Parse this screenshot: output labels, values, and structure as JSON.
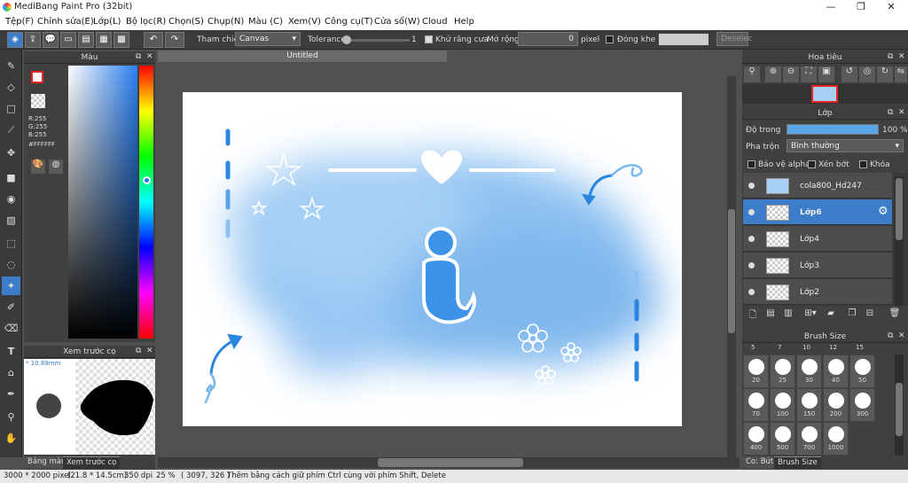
{
  "window": {
    "title": "MediBang Paint Pro (32bit)",
    "min": "—",
    "max": "❐",
    "close": "✕"
  },
  "menu": [
    "Tệp(F)",
    "Chỉnh sửa(E)",
    "Lớp(L)",
    "Bộ lọc(R)",
    "Chọn(S)",
    "Chụp(N)",
    "Màu (C)",
    "Xem(V)",
    "Công cụ(T)",
    "Cửa sổ(W)",
    "Cloud",
    "Help"
  ],
  "toolbar": {
    "ref_label": "Tham chiếu",
    "ref_value": "Canvas",
    "tol_label": "Tolerance",
    "tol_value": "1",
    "aa_label": "Khử răng cưa",
    "expand_label": "Mở rộng",
    "expand_value": "0",
    "pixel_label": "pixel",
    "gap_label": "Đóng khe hở",
    "deselect": "Deselec"
  },
  "color": {
    "title": "Màu",
    "r": "R:255",
    "g": "G:255",
    "b": "B:255",
    "hex": "#FFFFFF"
  },
  "preview": {
    "title": "Xem trước cọ",
    "size": "* 10.89mm",
    "tab1": "Bảng màu",
    "tab2": "Xem trước cọ"
  },
  "canvas": {
    "tab": "Untitled"
  },
  "navigator": {
    "title": "Hoa tiêu"
  },
  "layers": {
    "title": "Lớp",
    "opacity_label": "Độ trong",
    "opacity_value": "100 %",
    "opacity": 1.0,
    "blend_label": "Pha trộn",
    "blend_value": "Bình thường",
    "protect": "Bảo vệ alpha",
    "clip": "Xén bớt",
    "lock": "Khóa",
    "items": [
      {
        "name": "cola800_Hd247"
      },
      {
        "name": "Lớp6"
      },
      {
        "name": "Lớp4"
      },
      {
        "name": "Lớp3"
      },
      {
        "name": "Lớp2"
      }
    ]
  },
  "brushsize": {
    "title": "Brush Size",
    "top": [
      "5",
      "7",
      "10",
      "12",
      "15"
    ],
    "rows": [
      [
        "20",
        "25",
        "30",
        "40",
        "50"
      ],
      [
        "70",
        "100",
        "150",
        "200",
        "300"
      ],
      [
        "400",
        "500",
        "700",
        "1000"
      ]
    ],
    "tab1": "Co: Bút",
    "tab2": "Brush Size"
  },
  "status": {
    "size": "3000 * 2000 pixel",
    "cm": "(21.8 * 14.5cm)",
    "dpi": "350 dpi",
    "zoom": "25 %",
    "coords": "( 3097, 326 )",
    "hint": "Thêm bằng cách giữ phím Ctrl cùng với phím Shift, Delete"
  },
  "colors": {
    "accent": "#3d7cc9",
    "sky": "#7fb8f0",
    "drawing": "#3d93e8"
  }
}
